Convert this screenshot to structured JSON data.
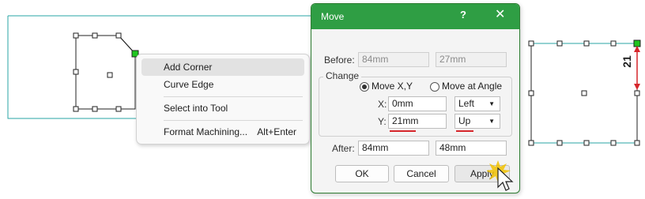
{
  "context_menu": {
    "items": [
      {
        "label": "Add Corner",
        "shortcut": ""
      },
      {
        "label": "Curve Edge",
        "shortcut": ""
      },
      {
        "label": "Select into Tool",
        "shortcut": ""
      },
      {
        "label": "Format Machining...",
        "shortcut": "Alt+Enter"
      }
    ],
    "highlighted_index": 0
  },
  "dialog": {
    "title": "Move",
    "help_glyph": "?",
    "close_glyph": "✕",
    "before": {
      "label": "Before:",
      "x": "84mm",
      "y": "27mm"
    },
    "change": {
      "group_label": "Change",
      "radio_move_xy": "Move X,Y",
      "radio_move_angle": "Move at Angle",
      "selected_radio": "Move X,Y",
      "x_label": "X:",
      "x_value": "0mm",
      "x_direction": "Left",
      "y_label": "Y:",
      "y_value": "21mm",
      "y_direction": "Up"
    },
    "after": {
      "label": "After:",
      "x": "84mm",
      "y": "48mm"
    },
    "buttons": {
      "ok": "OK",
      "cancel": "Cancel",
      "apply": "Apply"
    }
  },
  "preview": {
    "dimension_label": "21"
  },
  "colors": {
    "accent_green": "#2f9e44",
    "highlight_red": "#d6262b",
    "handle_green": "#1fc51f",
    "shape_edge": "#2aa6a6"
  }
}
